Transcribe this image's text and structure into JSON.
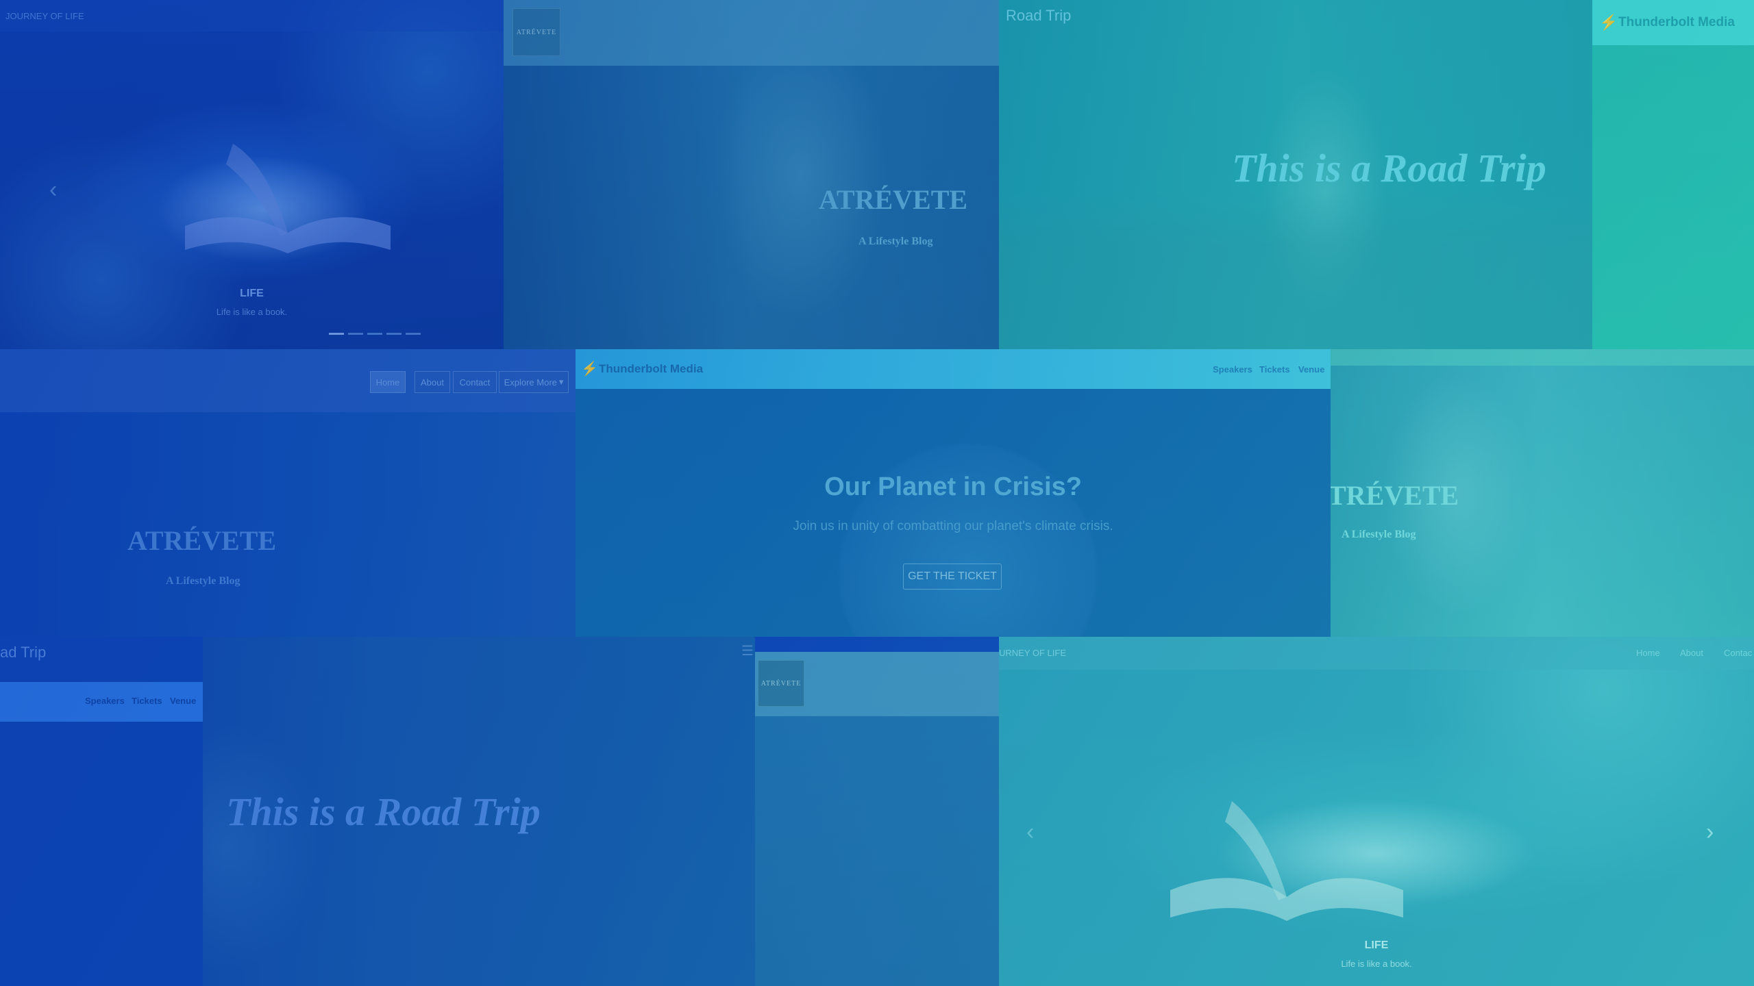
{
  "tiles": {
    "journey_top": {
      "brand": "JOURNEY OF LIFE",
      "slide_title": "LIFE",
      "slide_caption": "Life is like a book."
    },
    "atrevete_top": {
      "logo_text": "ATRÉVETE",
      "title": "ATRÉVETE",
      "subtitle": "A Lifestyle Blog"
    },
    "roadtrip_top": {
      "brand": "Road Trip",
      "headline": "This is a Road Trip"
    },
    "thunderbolt_badge": {
      "brand": "Thunderbolt Media"
    },
    "atrevete_nav": {
      "nav": [
        "Home",
        "About",
        "Contact",
        "Explore More"
      ],
      "title": "ATRÉVETE",
      "subtitle": "A Lifestyle Blog"
    },
    "thunderbolt_center": {
      "brand": "Thunderbolt Media",
      "nav": [
        "Speakers",
        "Tickets",
        "Venue"
      ],
      "headline": "Our Planet in Crisis?",
      "subhead": "Join us in unity of combatting our planet's climate crisis.",
      "cta": "GET THE TICKET"
    },
    "atrevete_right": {
      "title": "TRÉVETE",
      "subtitle": "A Lifestyle Blog"
    },
    "roadtrip_bottom": {
      "brand": "ad Trip",
      "nav": [
        "Speakers",
        "Tickets",
        "Venue"
      ],
      "headline": "This is a Road Trip"
    },
    "atrevete_bottom": {
      "logo_text": "ATRÉVETE"
    },
    "journey_bottom": {
      "brand": "URNEY OF LIFE",
      "nav": [
        "Home",
        "About",
        "Contac"
      ],
      "slide_title": "LIFE",
      "slide_caption": "Life is like a book."
    }
  },
  "icons": {
    "bolt": "lightning-bolt-icon",
    "chevron_left": "chevron-left-icon",
    "chevron_right": "chevron-right-icon",
    "caret_down": "caret-down-icon",
    "hamburger": "hamburger-menu-icon"
  },
  "colors": {
    "overlay_blue": "#0b3fb5",
    "overlay_teal": "#3fd6c6",
    "accent_cyan": "#43c7e0"
  }
}
